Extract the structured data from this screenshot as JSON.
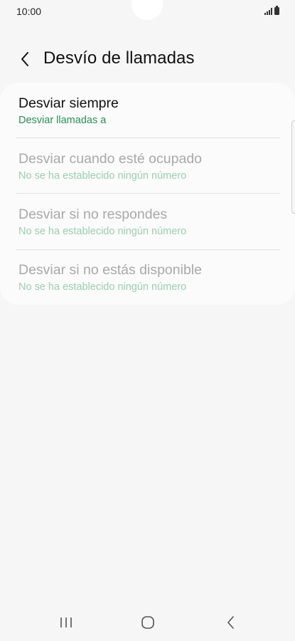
{
  "status_bar": {
    "time": "10:00"
  },
  "header": {
    "title": "Desvío de llamadas"
  },
  "forwarding_options": [
    {
      "title": "Desviar siempre",
      "subtitle": "Desviar llamadas a",
      "enabled": true
    },
    {
      "title": "Desviar cuando esté ocupado",
      "subtitle": "No se ha establecido ningún número",
      "enabled": false
    },
    {
      "title": "Desviar si no respondes",
      "subtitle": "No se ha establecido ningún número",
      "enabled": false
    },
    {
      "title": "Desviar si no estás disponible",
      "subtitle": "No se ha establecido ningún número",
      "enabled": false
    }
  ],
  "icons": {
    "back": "chevron-left-icon",
    "signal": "signal-icon",
    "battery": "battery-icon",
    "nav_recent": "recent-apps-icon",
    "nav_home": "home-icon",
    "nav_back": "back-icon"
  },
  "colors": {
    "accent_green": "#2a8f58",
    "disabled_green": "#9ccdb2",
    "background": "#f6f6f6",
    "card": "#fbfbfb"
  }
}
